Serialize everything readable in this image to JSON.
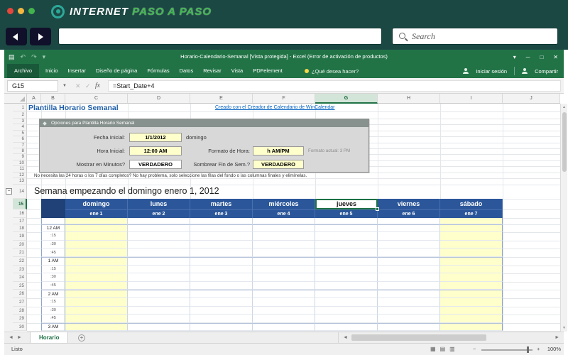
{
  "colors": {
    "topbar_teal": "#1c4843",
    "excel_green": "#217346",
    "table_header_blue": "#2b579a",
    "weekend_yellow": "#ffffcc",
    "input_yellow": "#ffffcc",
    "link_blue": "#0563c1",
    "logo_green": "#41b64e",
    "selection_green": "#1e7145"
  },
  "browser": {
    "logo_word1": "INTERNET",
    "logo_word2": "PASO A PASO",
    "search_placeholder": "Search"
  },
  "excel": {
    "title": "Horario-Calendario-Semanal [Vista protegida] - Excel (Error de activación de productos)",
    "ribbon_tabs": [
      "Archivo",
      "Inicio",
      "Insertar",
      "Diseño de página",
      "Fórmulas",
      "Datos",
      "Revisar",
      "Vista",
      "PDFelement"
    ],
    "tell_me": "¿Qué desea hacer?",
    "sign_in": "Iniciar sesión",
    "share": "Compartir",
    "name_box": "G15",
    "formula": "=Start_Date+4",
    "columns": [
      "A",
      "B",
      "C",
      "D",
      "E",
      "F",
      "G",
      "H",
      "I",
      "J"
    ],
    "active_column": "G",
    "active_row": 15,
    "row_count": 30,
    "sheet_tab": "Horario",
    "status": "Listo",
    "zoom": "100%"
  },
  "content": {
    "doc_title": "Plantilla Horario Semanal",
    "credit_link": "Creado con el Creador de Calendario de WinCalendar",
    "options": {
      "header": "Opciones para Plantilla Horario Semanal",
      "start_date_label": "Fecha Inicial:",
      "start_date_value": "1/1/2012",
      "start_date_day": "domingo",
      "start_time_label": "Hora Inicial:",
      "start_time_value": "12:00 AM",
      "time_format_label": "Formato de Hora:",
      "time_format_value": "h AM/PM",
      "time_format_hint": "Formato actual: 3 PM",
      "show_minutes_label": "Mostrar en Minutos?",
      "show_minutes_value": "VERDADERO",
      "shade_weekend_label": "Sombrear Fin de Sem.?",
      "shade_weekend_value": "VERDADERO"
    },
    "note": "No necesita las 24 horas o los 7 días completos? No hay problema, solo seleccione las filas del fondo o las columnas finales y elimínelas.",
    "week_title": "Semana empezando el domingo enero 1, 2012",
    "day_headers": [
      "domingo",
      "lunes",
      "martes",
      "miércoles",
      "jueves",
      "viernes",
      "sábado"
    ],
    "date_headers": [
      "ene 1",
      "ene 2",
      "ene 3",
      "ene 4",
      "ene 5",
      "ene 6",
      "ene 7"
    ],
    "time_rows": [
      "12 AM",
      ":15",
      ":30",
      ":45",
      "1 AM",
      ":15",
      ":30",
      ":45",
      "2 AM",
      ":15",
      ":30",
      ":45",
      "3 AM"
    ],
    "selected_day_index": 4,
    "weekend_day_indexes": [
      0,
      6
    ]
  }
}
